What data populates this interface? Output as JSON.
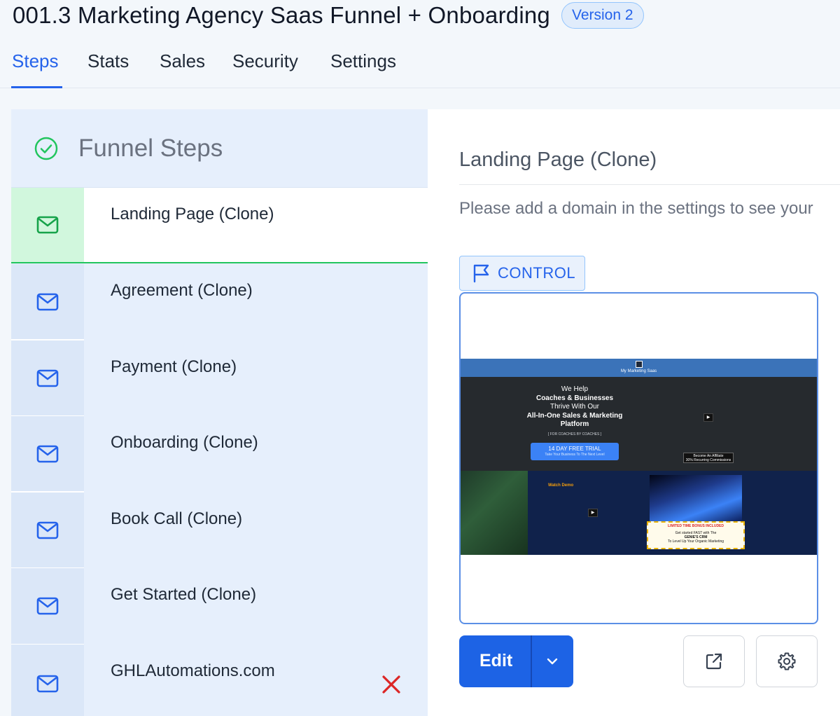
{
  "header": {
    "title": "001.3 Marketing Agency Saas Funnel + Onboarding",
    "version_badge": "Version 2"
  },
  "tabs": [
    {
      "label": "Steps",
      "active": true
    },
    {
      "label": "Stats",
      "active": false
    },
    {
      "label": "Sales",
      "active": false
    },
    {
      "label": "Security",
      "active": false
    },
    {
      "label": "Settings",
      "active": false
    }
  ],
  "funnel_steps": {
    "title": "Funnel Steps",
    "steps": [
      {
        "label": "Landing Page (Clone)",
        "active": true,
        "icon": "mail-icon"
      },
      {
        "label": "Agreement (Clone)",
        "active": false,
        "icon": "mail-icon"
      },
      {
        "label": "Payment (Clone)",
        "active": false,
        "icon": "mail-icon"
      },
      {
        "label": "Onboarding (Clone)",
        "active": false,
        "icon": "mail-icon"
      },
      {
        "label": "Book Call (Clone)",
        "active": false,
        "icon": "mail-icon"
      },
      {
        "label": "Get Started (Clone)",
        "active": false,
        "icon": "mail-icon"
      },
      {
        "label": "GHLAutomations.com",
        "active": false,
        "icon": "mail-icon",
        "has_delete": true
      }
    ]
  },
  "detail": {
    "page_title": "Landing Page (Clone)",
    "domain_message": "Please add a domain in the settings to see your",
    "control_label": "CONTROL",
    "edit_label": "Edit"
  },
  "preview": {
    "brand": "My Marketing Saas",
    "hero_line1": "We Help",
    "hero_line2": "Coaches & Businesses",
    "hero_line3": "Thrive With Our",
    "hero_line4": "All-In-One Sales & Marketing",
    "hero_line5": "Platform",
    "hero_small": "[ FOR COACHES BY COACHES ]",
    "cta_title": "14 DAY FREE TRIAL",
    "cta_sub": "Take Your Business To The Next Level",
    "affiliate_title": "Become An Affiliate",
    "affiliate_sub": "30% Recurring Commissions",
    "watch_demo": "Watch Demo",
    "bonus_title": "LIMITED TIME BONUS INCLUDED",
    "bonus_line1": "Get started FAST with The",
    "bonus_line2": "GENIE'S CRM",
    "bonus_line3": "To Level Up Your Organic Marketing"
  },
  "colors": {
    "accent": "#2563eb",
    "active_step_green": "#22c55e",
    "delete_red": "#dc2626",
    "panel_bg": "#e6effc"
  }
}
